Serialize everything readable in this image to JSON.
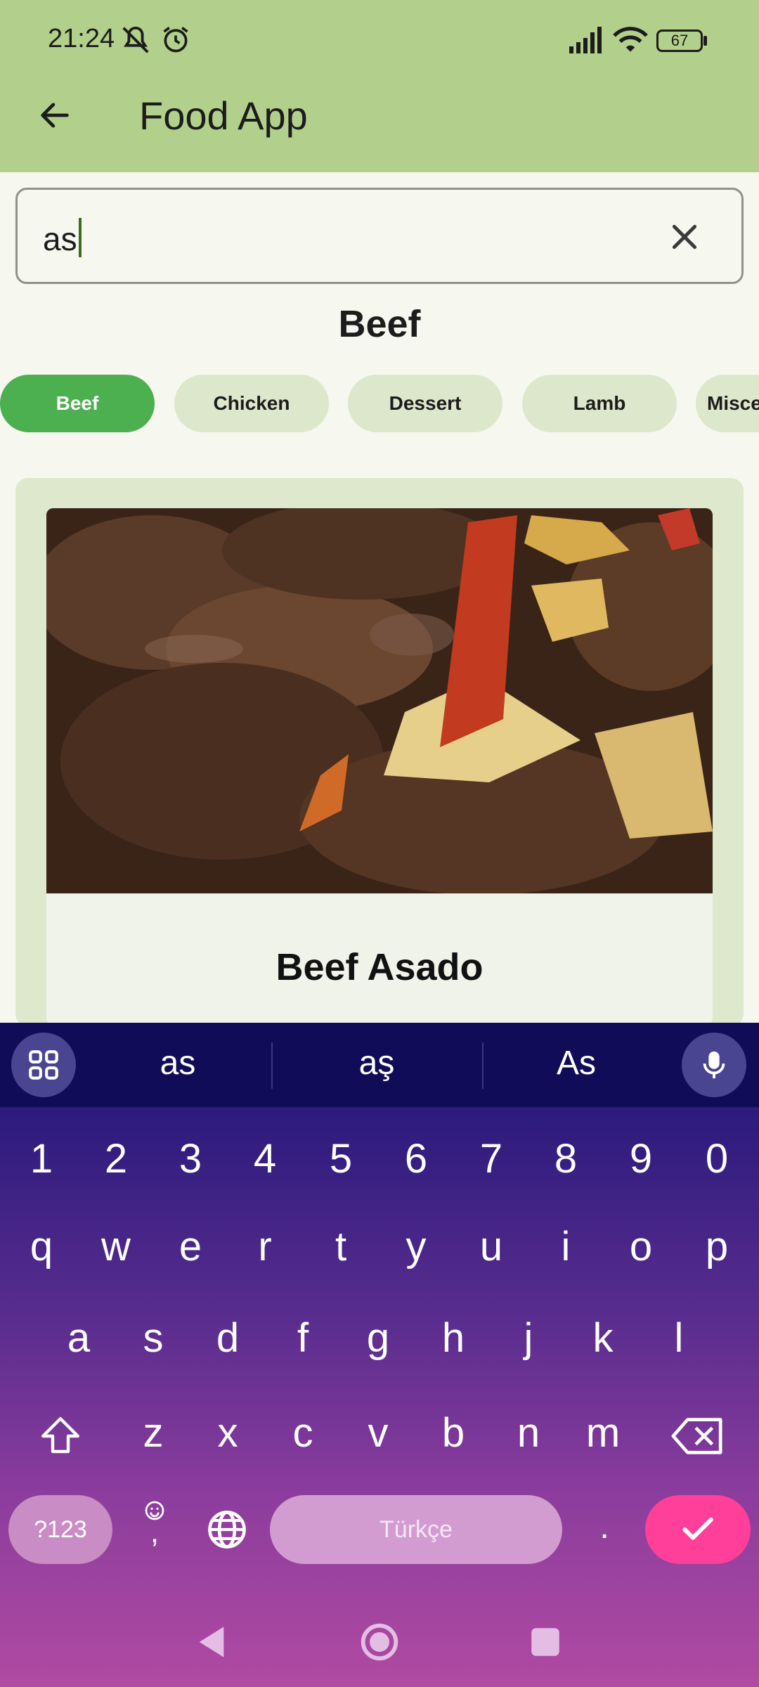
{
  "status_bar": {
    "time": "21:24",
    "battery": "67"
  },
  "app_bar": {
    "title": "Food App"
  },
  "search": {
    "value": "as"
  },
  "category": {
    "title": "Beef"
  },
  "chips": [
    {
      "label": "Beef",
      "active": true
    },
    {
      "label": "Chicken",
      "active": false
    },
    {
      "label": "Dessert",
      "active": false
    },
    {
      "label": "Lamb",
      "active": false
    },
    {
      "label": "Misce",
      "active": false
    }
  ],
  "meals": [
    {
      "name": "Beef Asado"
    }
  ],
  "keyboard": {
    "suggestions": [
      "as",
      "aş",
      "As"
    ],
    "row_numbers": [
      "1",
      "2",
      "3",
      "4",
      "5",
      "6",
      "7",
      "8",
      "9",
      "0"
    ],
    "row1": [
      "q",
      "w",
      "e",
      "r",
      "t",
      "y",
      "u",
      "i",
      "o",
      "p"
    ],
    "row2": [
      "a",
      "s",
      "d",
      "f",
      "g",
      "h",
      "j",
      "k",
      "l"
    ],
    "row3": [
      "z",
      "x",
      "c",
      "v",
      "b",
      "n",
      "m"
    ],
    "symbols_key": "?123",
    "emoji_comma_key": ",",
    "space_label": "Türkçe",
    "period_key": "."
  },
  "colors": {
    "app_bar": "#b2d08b",
    "chip_active": "#4caf50",
    "enter_key": "#ff3f9a"
  }
}
